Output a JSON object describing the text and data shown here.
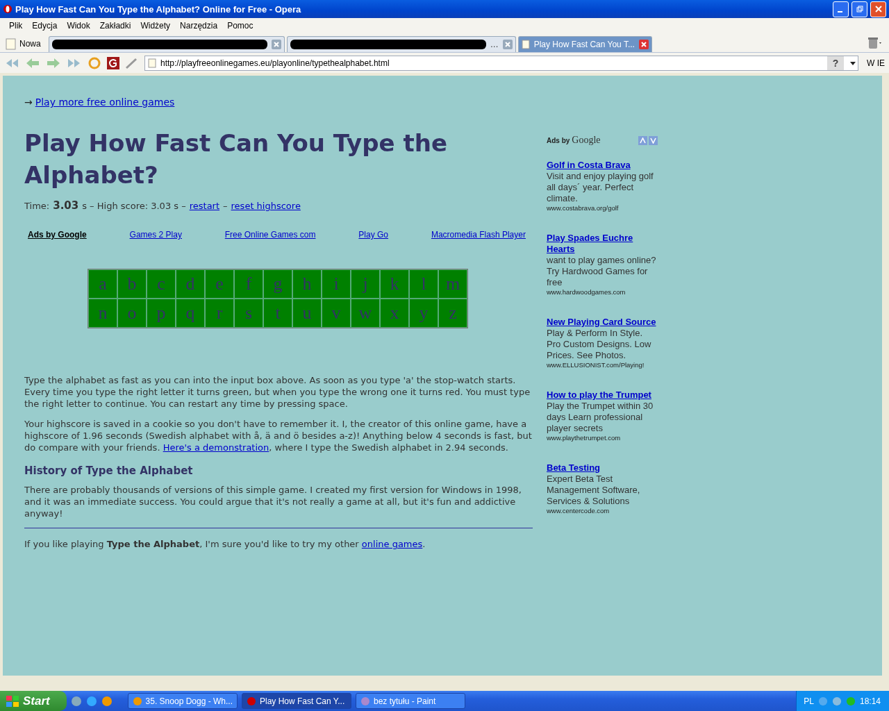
{
  "window": {
    "title": "Play How Fast Can You Type the Alphabet? Online for Free - Opera"
  },
  "menu": [
    "Plik",
    "Edycja",
    "Widok",
    "Zakładki",
    "Widżety",
    "Narzędzia",
    "Pomoc"
  ],
  "tabs": [
    {
      "label": "Nowa",
      "kind": "new"
    },
    {
      "kind": "redacted",
      "selected": false
    },
    {
      "label": "…",
      "kind": "redacted",
      "selected": false
    },
    {
      "label": "Play How Fast Can You T...",
      "kind": "page",
      "selected": true
    }
  ],
  "address": {
    "value": "http://playfreeonlinegames.eu/playonline/typethealphabet.html",
    "search_label": "W IE",
    "help": "?"
  },
  "page": {
    "top_link": {
      "arrow": "→",
      "label": "Play more free online games"
    },
    "heading": "Play How Fast Can You Type the Alphabet?",
    "score": {
      "time_label": "Time:",
      "time": "3.03",
      "time_unit": "s – High score: 3.03 s –",
      "restart": "restart",
      "sep": "–",
      "reset": "reset highscore"
    },
    "ad_links": [
      {
        "label": "Ads by Google",
        "kind": "title"
      },
      {
        "label": "Games 2 Play",
        "kind": "link"
      },
      {
        "label": "Free Online Games com",
        "kind": "link"
      },
      {
        "label": "Play Go",
        "kind": "link"
      },
      {
        "label": "Macromedia Flash Player",
        "kind": "link"
      }
    ],
    "letters": [
      "a",
      "b",
      "c",
      "d",
      "e",
      "f",
      "g",
      "h",
      "i",
      "j",
      "k",
      "l",
      "m",
      "n",
      "o",
      "p",
      "q",
      "r",
      "s",
      "t",
      "u",
      "v",
      "w",
      "x",
      "y",
      "z"
    ],
    "paragraphs": [
      {
        "text": "Type the alphabet as fast as you can into the input box above. As soon as you type 'a' the stop-watch starts. Every time you type the right letter it turns green, but when you type the wrong one it turns red. You must type the right letter to continue. You can restart any time by pressing space."
      },
      {
        "text": "Your highscore is saved in a cookie so you don't have to remember it. I, the creator of this online game, have a highscore of 1.96 seconds (Swedish alphabet with å, ä and ö besides a-z)! Anything below 4 seconds is fast, but do compare with your friends. ",
        "link": "Here's a demonstration",
        "after": ", where I type the Swedish alphabet in 2.94 seconds."
      }
    ],
    "subheading": "History of Type the Alphabet",
    "history": "There are probably thousands of versions of this simple game. I created my first version for Windows in 1998, and it was an immediate success. You could argue that it's not really a game at all, but it's fun and addictive anyway!",
    "footer": {
      "text": "If you like playing **Type the Alphabet**, I'm sure you'd like to try my other ",
      "link": "online games",
      "after": "."
    }
  },
  "ads": {
    "label": "Ads by",
    "brand": "Google",
    "items": [
      {
        "title": "Golf in Costa Brava",
        "text": "Visit and enjoy playing golf all days´ year. Perfect climate.",
        "url": "www.costabrava.org/golf"
      },
      {
        "title": "Play Spades Euchre Hearts",
        "text": "want to play games online? Try Hardwood Games for free",
        "url": "www.hardwoodgames.com"
      },
      {
        "title": "New Playing Card Source",
        "text": "Play & Perform In Style. Pro Custom Designs. Low Prices. See Photos.",
        "url": "www.ELLUSIONIST.com/Playing!"
      },
      {
        "title": "How to play the Trumpet",
        "text": "Play the Trumpet within 30 days Learn professional player secrets",
        "url": "www.playthetrumpet.com"
      },
      {
        "title": "Beta Testing",
        "text": "Expert Beta Test Management Software, Services & Solutions",
        "url": "www.centercode.com"
      }
    ]
  },
  "taskbar": {
    "start": "Start",
    "tasks": [
      {
        "label": "35. Snoop Dogg - Wh...",
        "selected": false
      },
      {
        "label": "Play How Fast Can Y...",
        "selected": true
      },
      {
        "label": "bez tytułu - Paint",
        "selected": false
      }
    ],
    "lang": "PL",
    "time": "18:14"
  }
}
